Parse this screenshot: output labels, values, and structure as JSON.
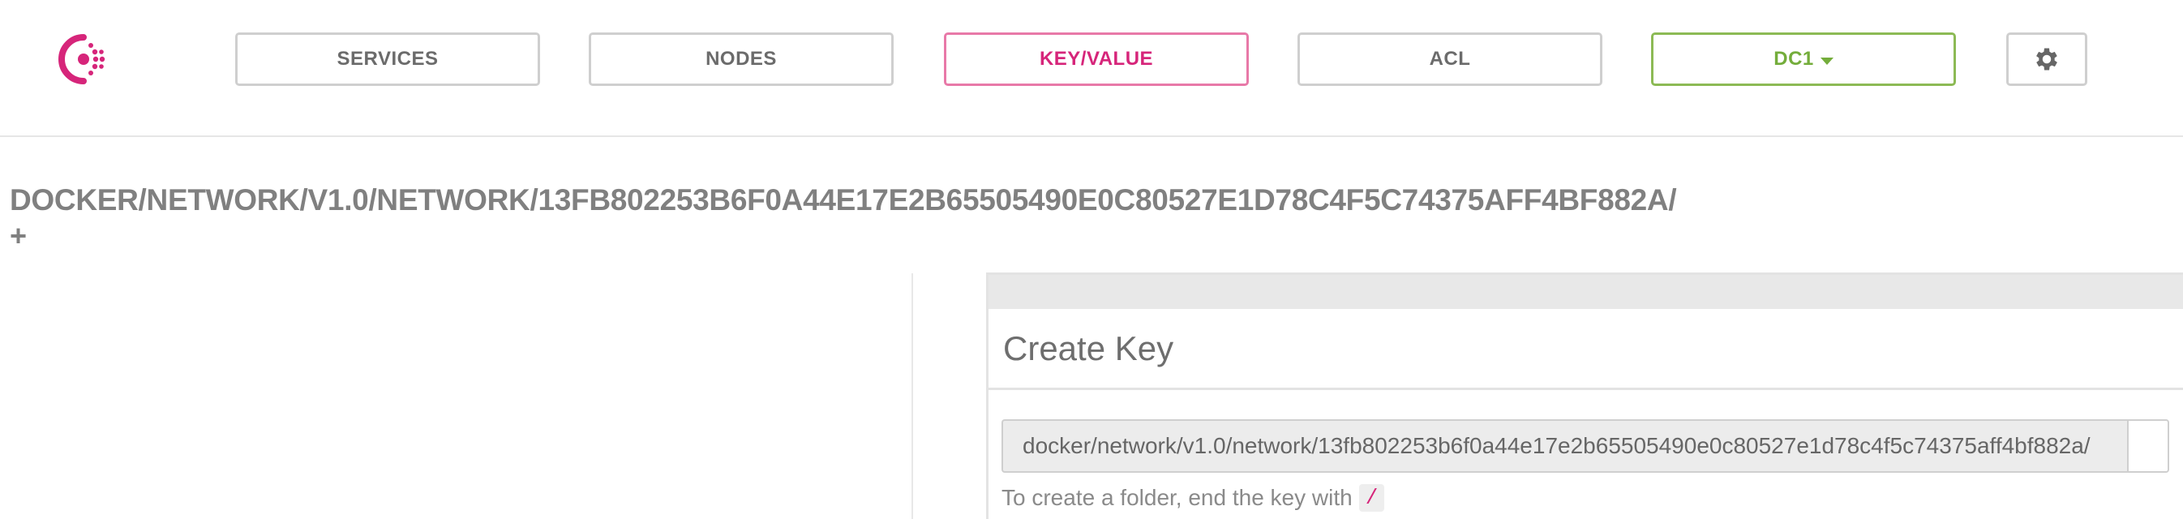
{
  "colors": {
    "brand": "#d6257a",
    "active_border": "#e879a8",
    "datacenter": "#74ad3b",
    "border": "#cfcfcf"
  },
  "header": {
    "logo_icon": "consul-logo-icon",
    "nav": [
      {
        "label": "SERVICES",
        "active": false
      },
      {
        "label": "NODES",
        "active": false
      },
      {
        "label": "KEY/VALUE",
        "active": true
      },
      {
        "label": "ACL",
        "active": false
      }
    ],
    "datacenter": {
      "label": "DC1",
      "icon": "caret-down-icon"
    },
    "settings_icon": "gear-icon"
  },
  "breadcrumb": {
    "path": "DOCKER/NETWORK/V1.0/NETWORK/13FB802253B6F0A44E17E2B65505490E0C80527E1D78C4F5C74375AFF4BF882A/",
    "add_label": "+"
  },
  "create_key": {
    "title": "Create Key",
    "key_value": "docker/network/v1.0/network/13fb802253b6f0a44e17e2b65505490e0c80527e1d78c4f5c74375aff4bf882a/",
    "help_text": "To create a folder, end the key with",
    "help_code": "/"
  }
}
